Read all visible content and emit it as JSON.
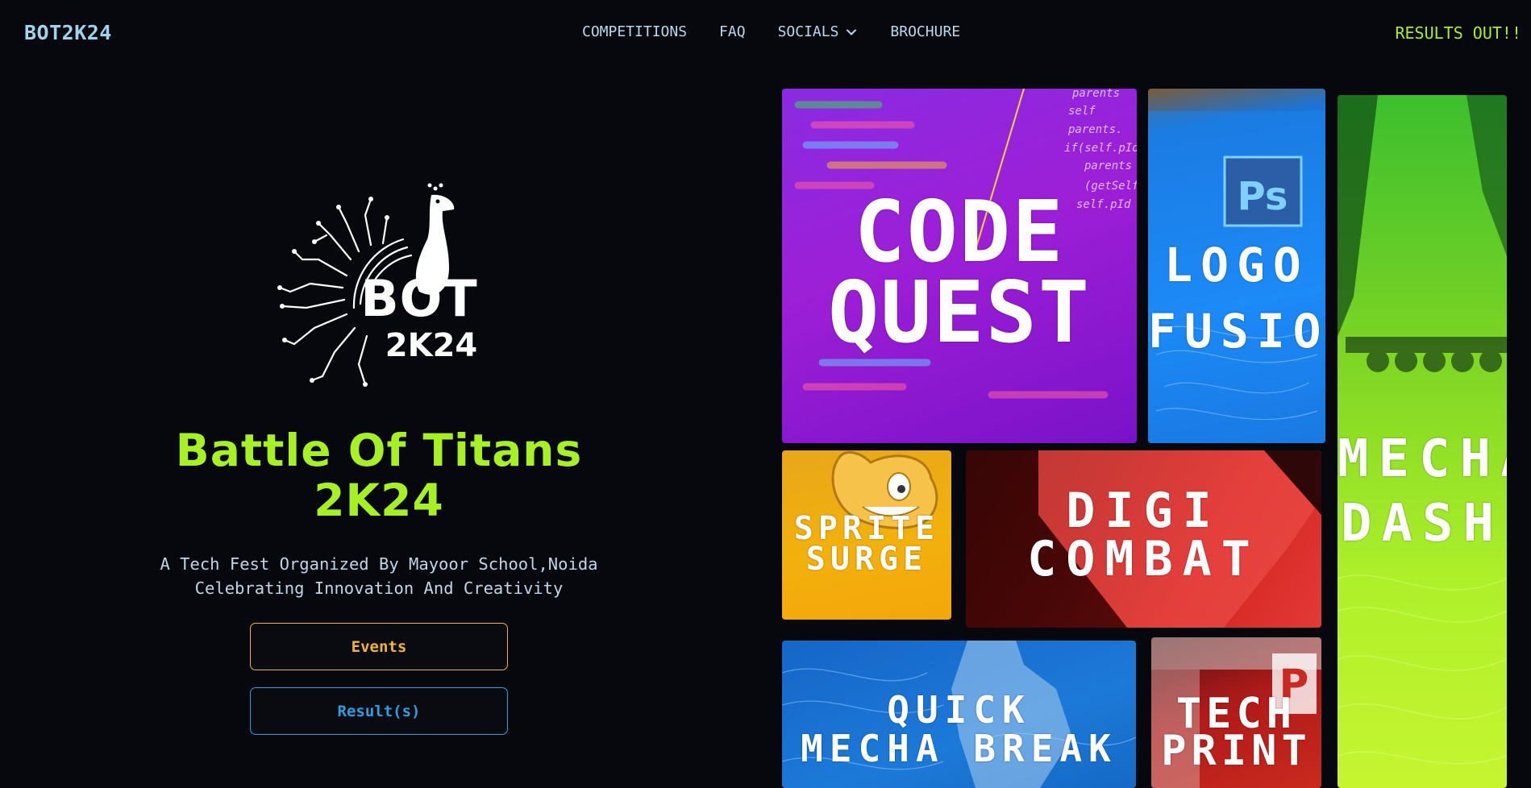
{
  "nav": {
    "brand": "BOT2K24",
    "items": [
      {
        "label": "COMPETITIONS"
      },
      {
        "label": "FAQ"
      },
      {
        "label": "SOCIALS",
        "icon": "chevron-down-icon"
      },
      {
        "label": "BROCHURE"
      }
    ],
    "results_link": "RESULTS OUT!!"
  },
  "hero": {
    "logo_text": "BOT 2K24",
    "title_line1": "Battle Of Titans",
    "title_line2": "2K24",
    "subtitle_line1": "A Tech Fest Organized By Mayoor School,Noida",
    "subtitle_line2": "Celebrating Innovation And Creativity",
    "events_button": "Events",
    "results_button": "Result(s)"
  },
  "competitions": [
    {
      "id": "code-quest",
      "title": "CODE\nQUEST",
      "color": "#9d1fd6"
    },
    {
      "id": "logo-fusion",
      "title": "LOGO\nFUSION",
      "color": "#1e90ff"
    },
    {
      "id": "mecha-dash",
      "title": "MECHA\nDASH",
      "color": "#aef02a"
    },
    {
      "id": "sprite-surge",
      "title": "SPRITE\nSURGE",
      "color": "#f3b10c"
    },
    {
      "id": "digi-combat",
      "title": "DIGI\nCOMBAT",
      "color": "#d2221f"
    },
    {
      "id": "quick-mecha-break",
      "title": "QUICK\nMECHA BREAK",
      "color": "#1d79d8"
    },
    {
      "id": "tech-print",
      "title": "TECH\nPRINT",
      "color": "#c92a1c"
    }
  ],
  "colors": {
    "accent_green": "#a8f026",
    "accent_amber": "#f1b530",
    "accent_blue": "#2d9ee0",
    "background": "#07080d"
  }
}
